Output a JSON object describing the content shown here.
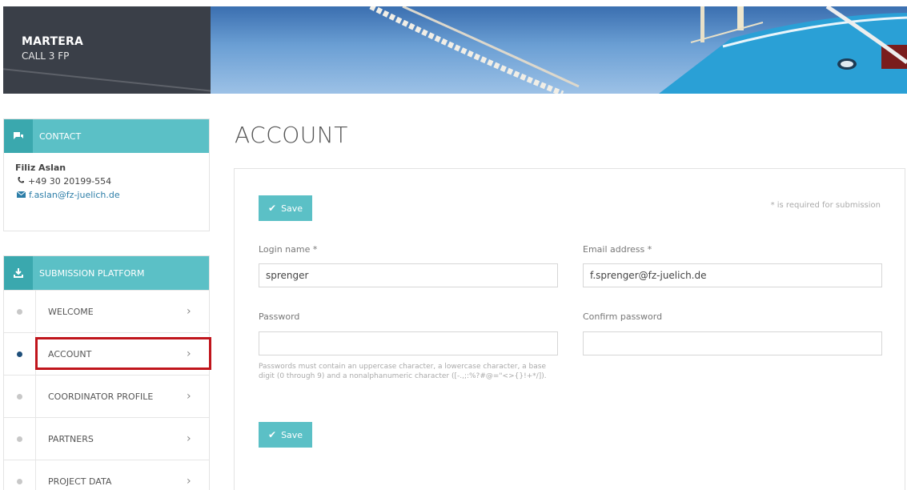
{
  "brand": {
    "title": "MARTERA",
    "subtitle": "CALL 3 FP"
  },
  "contact": {
    "header": "CONTACT",
    "name": "Filiz Aslan",
    "phone": "+49 30 20199-554",
    "email": "f.aslan@fz-juelich.de"
  },
  "platform": {
    "header": "SUBMISSION PLATFORM",
    "items": [
      {
        "label": "WELCOME"
      },
      {
        "label": "ACCOUNT"
      },
      {
        "label": "COORDINATOR PROFILE"
      },
      {
        "label": "PARTNERS"
      },
      {
        "label": "PROJECT DATA"
      }
    ]
  },
  "page": {
    "title": "ACCOUNT",
    "save_label": "Save",
    "required_note": "* is required for submission",
    "login": {
      "label": "Login name *",
      "value": "sprenger"
    },
    "email": {
      "label": "Email address *",
      "value": "f.sprenger@fz-juelich.de"
    },
    "password": {
      "label": "Password",
      "value": ""
    },
    "confirm": {
      "label": "Confirm password",
      "value": ""
    },
    "password_hint": "Passwords must contain an uppercase character, a lowercase character, a base digit (0 through 9) and a nonalphanumeric character ([-.,;:%?#@=\"<>{}!+*/]).",
    "save_label_bottom": "Save"
  },
  "colors": {
    "accent": "#5bc0c6",
    "accent_dark": "#3aa8ae",
    "brand_bg": "#3a3f48",
    "active_dot": "#1f4f7a",
    "highlight": "#c0151c"
  },
  "icons": [
    "chat-icon",
    "phone-icon",
    "mail-icon",
    "download-icon",
    "chevron-right-icon",
    "check-icon"
  ]
}
